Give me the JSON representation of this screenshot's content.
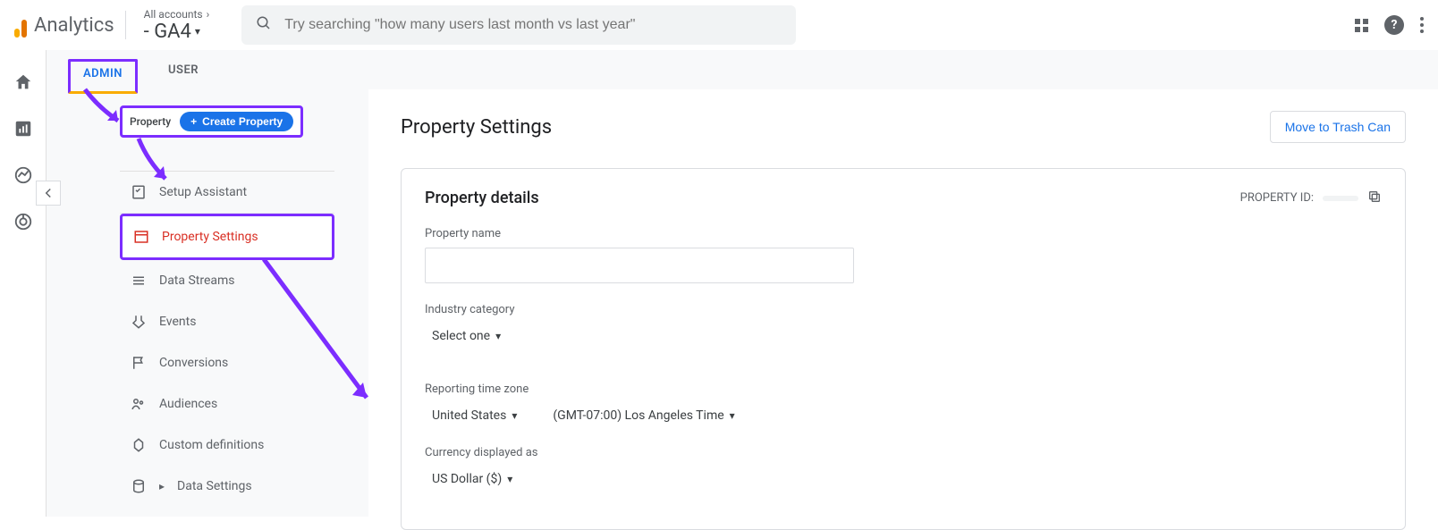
{
  "header": {
    "logo_text": "Analytics",
    "accounts_label": "All accounts",
    "property_suffix": "- GA4",
    "search_placeholder": "Try searching \"how many users last month vs last year\""
  },
  "tabs": {
    "admin": "ADMIN",
    "user": "USER"
  },
  "property_col": {
    "label": "Property",
    "create_btn": "Create Property",
    "items": {
      "setup_assistant": "Setup Assistant",
      "property_settings": "Property Settings",
      "data_streams": "Data Streams",
      "events": "Events",
      "conversions": "Conversions",
      "audiences": "Audiences",
      "custom_definitions": "Custom definitions",
      "data_settings": "Data Settings"
    }
  },
  "content": {
    "title": "Property Settings",
    "trash_btn": "Move to Trash Can",
    "details_heading": "Property details",
    "property_id_label": "PROPERTY ID:",
    "property_id_value": " ",
    "fields": {
      "name_label": "Property name",
      "name_value": "",
      "industry_label": "Industry category",
      "industry_value": "Select one",
      "tz_label": "Reporting time zone",
      "tz_country": "United States",
      "tz_offset": "(GMT-07:00) Los Angeles Time",
      "currency_label": "Currency displayed as",
      "currency_value": "US Dollar ($)"
    }
  }
}
